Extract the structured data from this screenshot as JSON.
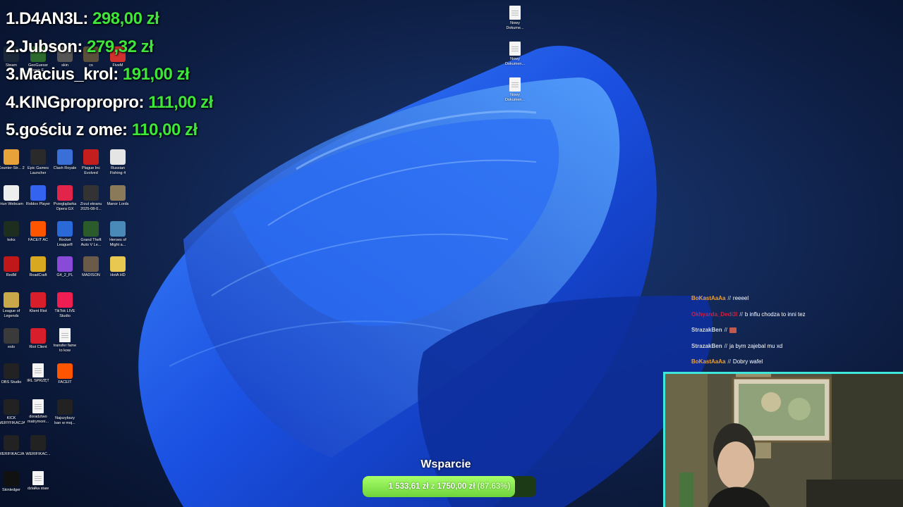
{
  "leaderboard": [
    {
      "rank": "1.",
      "name": "D4AN3L:",
      "amount": "298,00 zł"
    },
    {
      "rank": "2.",
      "name": "Jubson:",
      "amount": "279,32 zł"
    },
    {
      "rank": "3.",
      "name": "Macius_krol:",
      "amount": "191,00 zł"
    },
    {
      "rank": "4.",
      "name": "KINGpropropro:",
      "amount": "111,00 zł"
    },
    {
      "rank": "5.",
      "name": "gościu z ome:",
      "amount": "110,00 zł"
    }
  ],
  "desktop_icons": [
    {
      "label": "Steam",
      "icon": "steam-icon",
      "color": "#1b2838"
    },
    {
      "label": "GeoGuessr Steam E...",
      "icon": "geoguessr-icon",
      "color": "#2d6a2d"
    },
    {
      "label": "skin",
      "icon": "skin-icon",
      "color": "#555555"
    },
    {
      "label": "cs",
      "icon": "cs-icon",
      "color": "#5a4f3a"
    },
    {
      "label": "FiveM",
      "icon": "fivem-icon",
      "color": "#d2312e"
    },
    {
      "label": "Counter-Str... 2",
      "icon": "counter-strike-icon",
      "color": "#e8a23a"
    },
    {
      "label": "Epic Games Launcher",
      "icon": "epic-games-icon",
      "color": "#2a2a2a"
    },
    {
      "label": "Clash Royale",
      "icon": "clash-royale-icon",
      "color": "#3a6fd8"
    },
    {
      "label": "Plague Inc Evolved",
      "icon": "plague-inc-icon",
      "color": "#c41e1e"
    },
    {
      "label": "Russian Fishing 4",
      "icon": "russian-fishing-icon",
      "color": "#e5e5e5"
    },
    {
      "label": "Iriun Webcam",
      "icon": "iriun-webcam-icon",
      "color": "#eeeeee"
    },
    {
      "label": "Roblox Player",
      "icon": "roblox-icon",
      "color": "#3463f0"
    },
    {
      "label": "Przeglądarka Opera GX",
      "icon": "opera-gx-icon",
      "color": "#e2244a"
    },
    {
      "label": "Zrzut ekranu 2025-08-0...",
      "icon": "screenshot-icon",
      "color": "#333333"
    },
    {
      "label": "Manor Lords",
      "icon": "manor-lords-icon",
      "color": "#8a7a5a"
    },
    {
      "label": "koks",
      "icon": "koks-icon",
      "color": "#1e2e1e"
    },
    {
      "label": "FACEIT AC",
      "icon": "faceit-ac-icon",
      "color": "#ff5500"
    },
    {
      "label": "Rocket League®",
      "icon": "rocket-league-icon",
      "color": "#2a6ad8"
    },
    {
      "label": "Grand Theft Auto V Le...",
      "icon": "gta-icon",
      "color": "#2b5a2b"
    },
    {
      "label": "Heroes of Might a...",
      "icon": "heroes-icon",
      "color": "#4a8ab8"
    },
    {
      "label": "RedM",
      "icon": "redm-icon",
      "color": "#c01818"
    },
    {
      "label": "RoadCraft",
      "icon": "roadcraft-icon",
      "color": "#d8a820"
    },
    {
      "label": "G4_2_PL",
      "icon": "g4-icon",
      "color": "#8a4ad8"
    },
    {
      "label": "MADISON",
      "icon": "madison-icon",
      "color": "#6a5a4a"
    },
    {
      "label": "HotA HD",
      "icon": "hota-icon",
      "color": "#e8c850"
    },
    {
      "label": "League of Legends",
      "icon": "league-of-legends-icon",
      "color": "#c8a848"
    },
    {
      "label": "Klient Riot",
      "icon": "riot-client-icon",
      "color": "#d81e2a"
    },
    {
      "label": "TikTok LIVE Studio",
      "icon": "tiktok-icon",
      "color": "#ee1d52"
    },
    {
      "label": "eslo",
      "icon": "eslo-icon",
      "color": "#3a3a3a"
    },
    {
      "label": "Riot Client",
      "icon": "riot-client-icon",
      "color": "#d81e2a"
    },
    {
      "label": "transfer fame to kow",
      "icon": "file-icon",
      "color": "#f4f4f4"
    },
    {
      "label": "OBS Studio",
      "icon": "obs-icon",
      "color": "#222222"
    },
    {
      "label": "IRL SPRZĘT",
      "icon": "document-icon",
      "color": "#f4f4f4"
    },
    {
      "label": "FACEIT",
      "icon": "faceit-icon",
      "color": "#ff5500"
    },
    {
      "label": "KICK WERYFIKACJA",
      "icon": "screenshot-icon",
      "color": "#222222"
    },
    {
      "label": "doradztwo matrymoni...",
      "icon": "file-icon",
      "color": "#f4f4f4"
    },
    {
      "label": "Najszybszy ban w moj...",
      "icon": "screenshot-icon",
      "color": "#222222"
    },
    {
      "label": "WERIFIKACJA",
      "icon": "screenshot-icon",
      "color": "#222222"
    },
    {
      "label": "WERIFIKAC...",
      "icon": "screenshot-icon",
      "color": "#222222"
    },
    {
      "label": "Skinledger",
      "icon": "skinledger-icon",
      "color": "#111111"
    },
    {
      "label": "działka staw",
      "icon": "file-icon",
      "color": "#f4f4f4"
    }
  ],
  "right_icons": [
    {
      "label": "Nowy Dokume...",
      "icon": "text-document-icon"
    },
    {
      "label": "Nowy Dokumen...",
      "icon": "text-document-icon"
    },
    {
      "label": "Nowy Dokumen...",
      "icon": "text-document-icon"
    }
  ],
  "chat": [
    {
      "user": "BoKastAaAa",
      "color": "#f0a030",
      "message": "reeeel"
    },
    {
      "user": "Okhyarda_Dedi3l",
      "color": "#d02040",
      "message": "b influ chodza to inni tez"
    },
    {
      "user": "StrazakBen",
      "color": "#cfd8e0",
      "message": ""
    },
    {
      "user": "StrazakBen",
      "color": "#cfd8e0",
      "message": "ja bym zajebal mu xd"
    },
    {
      "user": "BoKastAaAa",
      "color": "#f0a030",
      "message": "Dobry wafel"
    }
  ],
  "donation_goal": {
    "title": "Wsparcie",
    "current": "1 533,61 zł",
    "separator": "z",
    "target": "1750,00 zł",
    "percent_label": "(87.63%)",
    "progress": 0.8763
  },
  "colors": {
    "accent_green": "#3ee53b",
    "webcam_border": "#3fe6d9",
    "wallpaper_blue": "#1a4fe0"
  }
}
